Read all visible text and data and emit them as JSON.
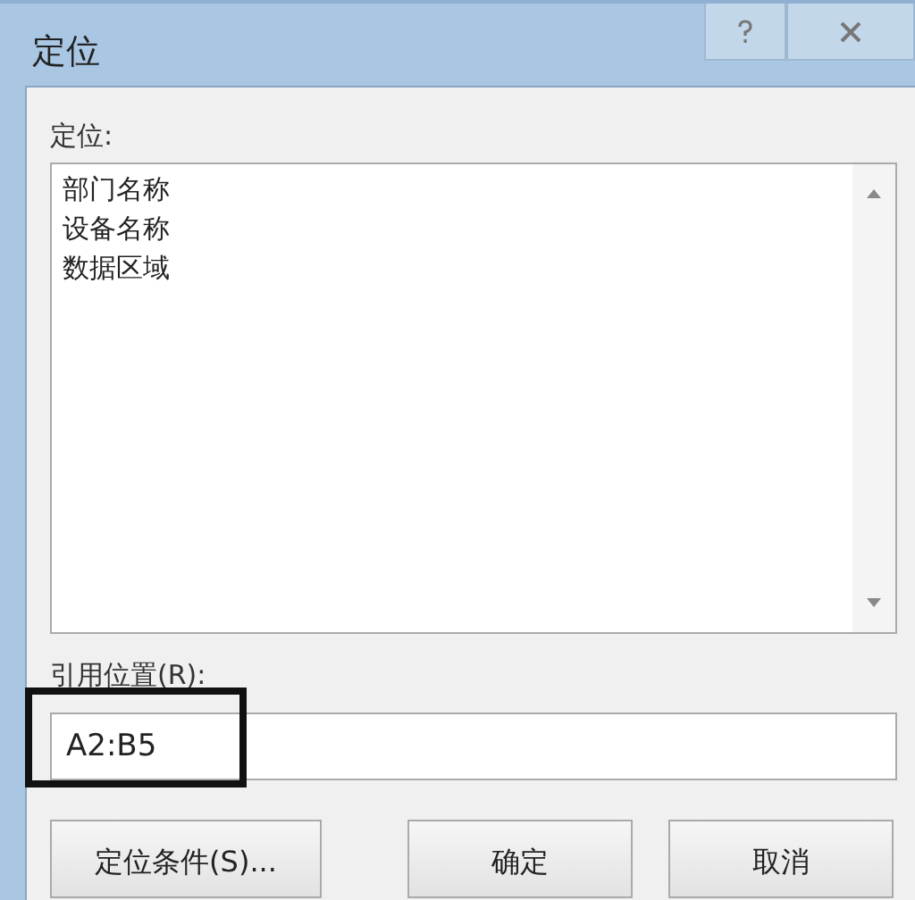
{
  "window": {
    "title": "定位"
  },
  "goto": {
    "label": "定位:",
    "items": [
      "部门名称",
      "设备名称",
      "数据区域"
    ]
  },
  "reference": {
    "label": "引用位置(R):",
    "value": "A2:B5",
    "highlighted": true
  },
  "buttons": [
    "定位条件(S)...",
    "确定",
    "取消"
  ]
}
